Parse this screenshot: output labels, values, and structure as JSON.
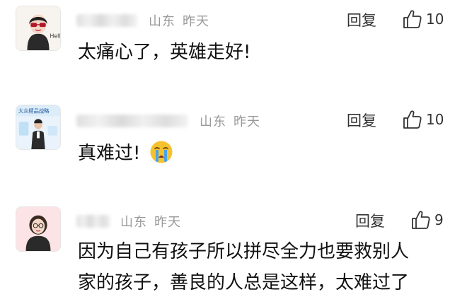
{
  "comments": [
    {
      "location": "山东",
      "time": "昨天",
      "reply_label": "回复",
      "likes": "10",
      "text": "太痛心了，英雄走好!",
      "avatar_badge_text": "Hello"
    },
    {
      "location": "山东",
      "time": "昨天",
      "reply_label": "回复",
      "likes": "10",
      "text": "真难过!",
      "avatar_text": "大众精品战略",
      "emoji_name": "crying-face-icon"
    },
    {
      "location": "山东",
      "time": "昨天",
      "reply_label": "回复",
      "likes": "9",
      "text_line1": "因为自己有孩子所以拼尽全力也要救别人",
      "text_line2": "家的孩子，善良的人总是这样，太难过了"
    }
  ],
  "colors": {
    "meta_text": "#9a9a9a",
    "body_text": "#111111",
    "action_text": "#333333",
    "emoji_yellow": "#f5c22e",
    "emoji_tears": "#4aa3e8"
  },
  "icons": {
    "like": "thumbs-up-icon"
  }
}
